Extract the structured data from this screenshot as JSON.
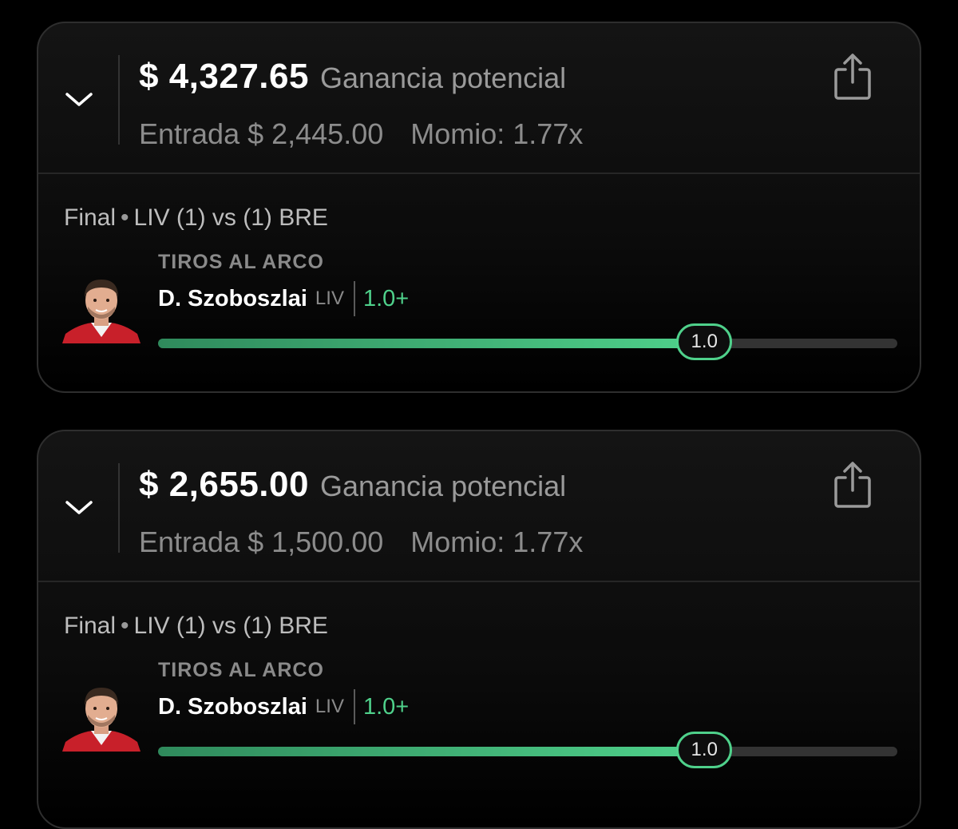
{
  "bets": [
    {
      "payout": "$ 4,327.65",
      "payout_label": "Ganancia potencial",
      "entry": "Entrada $ 2,445.00",
      "momio": "Momio: 1.77x",
      "match_status": "Final",
      "match": "LIV (1) vs (1) BRE",
      "market": "TIROS AL ARCO",
      "player": "D. Szoboszlai",
      "team": "LIV",
      "line": "1.0+",
      "progress_value": "1.0",
      "progress_fraction": 0.74
    },
    {
      "payout": "$ 2,655.00",
      "payout_label": "Ganancia potencial",
      "entry": "Entrada $ 1,500.00",
      "momio": "Momio: 1.77x",
      "match_status": "Final",
      "match": "LIV (1) vs (1) BRE",
      "market": "TIROS AL ARCO",
      "player": "D. Szoboszlai",
      "team": "LIV",
      "line": "1.0+",
      "progress_value": "1.0",
      "progress_fraction": 0.74
    }
  ],
  "colors": {
    "accent": "#4fd18b",
    "background": "#000000",
    "card_border": "#2e2e2e",
    "muted_text": "#8c8c8c"
  },
  "icons": {
    "expand": "chevron-down-icon",
    "share": "share-icon",
    "avatar": "player-avatar"
  }
}
